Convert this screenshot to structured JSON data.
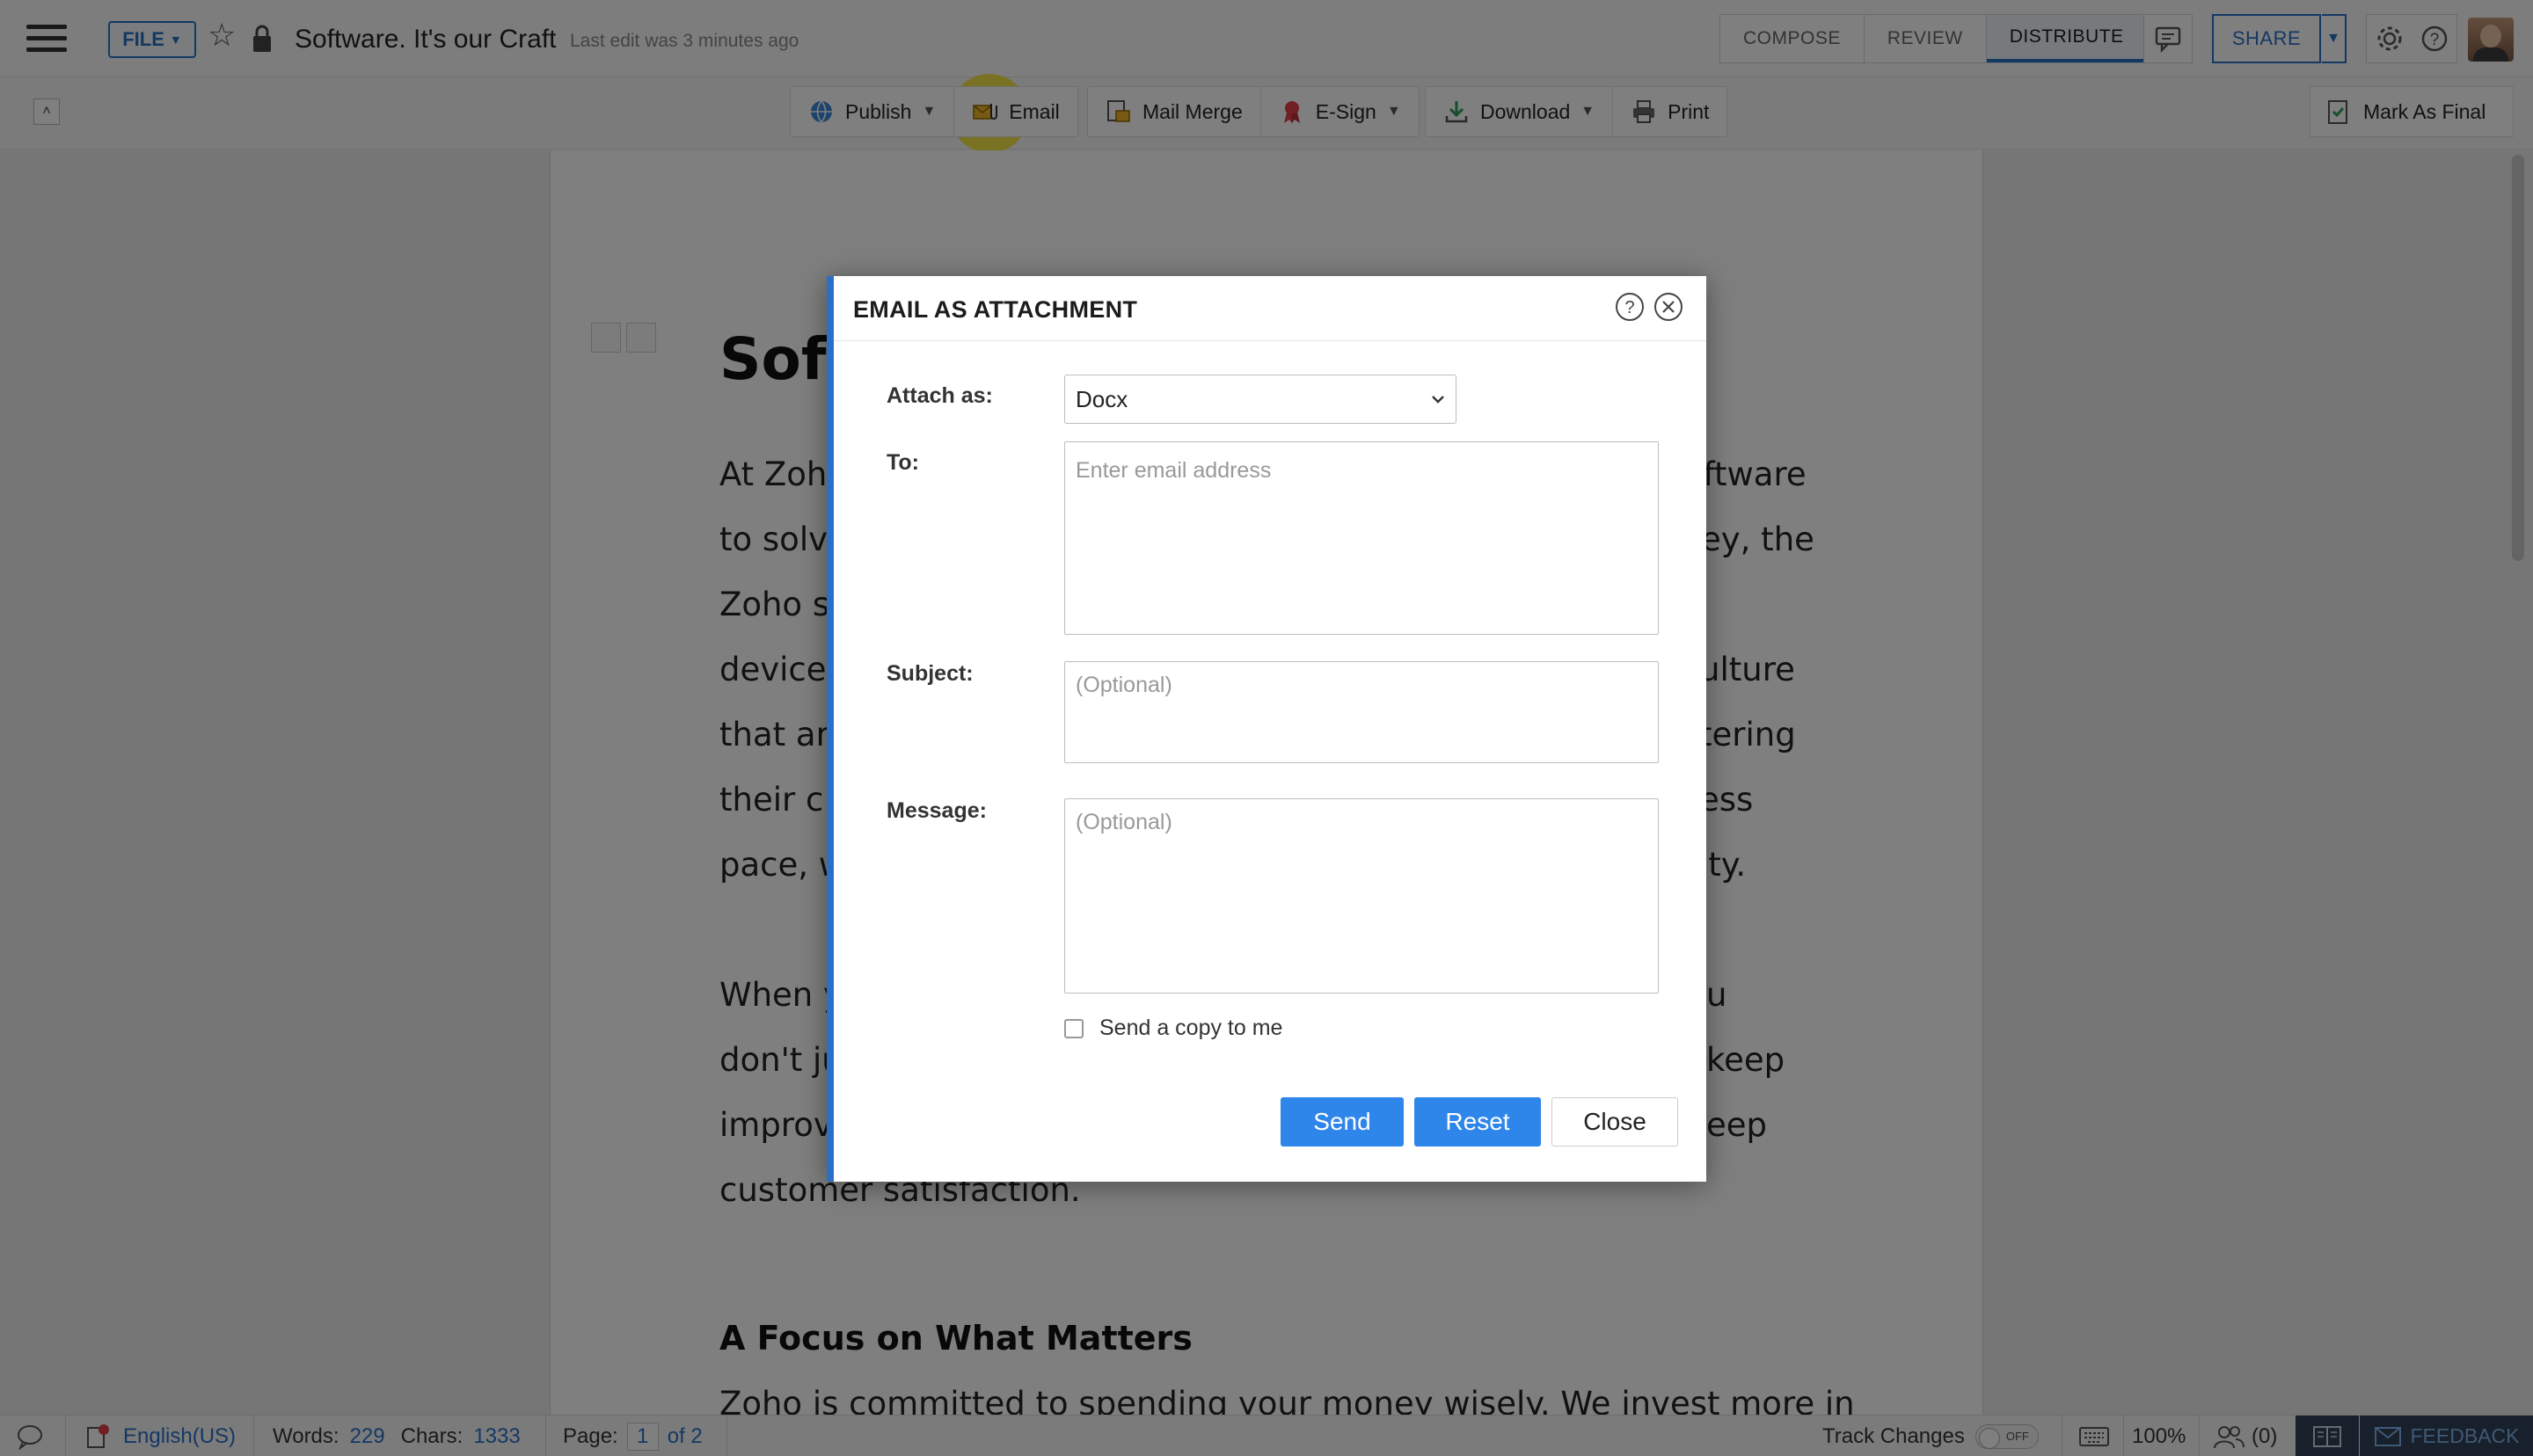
{
  "header": {
    "file_label": "FILE",
    "doc_title": "Software. It's our Craft",
    "last_edit": "Last edit was 3 minutes ago",
    "modes": [
      {
        "label": "COMPOSE"
      },
      {
        "label": "REVIEW"
      },
      {
        "label": "DISTRIBUTE"
      }
    ],
    "share_label": "SHARE"
  },
  "toolbar": {
    "publish": "Publish",
    "email": "Email",
    "mail_merge": "Mail Merge",
    "esign": "E-Sign",
    "download": "Download",
    "print": "Print",
    "mark_final": "Mark As Final"
  },
  "document": {
    "title_visible": "Soft",
    "lines": [
      {
        "left": "At Zoho",
        "right": "oftware"
      },
      {
        "left": "to solve",
        "right": "ey, the"
      },
      {
        "left": "Zoho su",
        "right": ""
      },
      {
        "left": "devices",
        "right": "ulture"
      },
      {
        "left": "that are",
        "right": "tering"
      },
      {
        "left": "their  c",
        "right": "ess"
      },
      {
        "left": "pace, w",
        "right": "ity."
      },
      {
        "left": "When y",
        "right": "u"
      },
      {
        "left": "don't ju",
        "right": "keep"
      },
      {
        "left": "improv",
        "right": "eep"
      },
      {
        "left": "customer satisfaction.",
        "right": ""
      }
    ],
    "heading2": "A Focus on What Matters",
    "last_line": "Zoho is committed to spending your money wisely. We invest more in"
  },
  "dialog": {
    "title": "EMAIL AS ATTACHMENT",
    "attach_label": "Attach as:",
    "attach_value": "Docx",
    "to_label": "To:",
    "to_placeholder": "Enter email address",
    "subject_label": "Subject:",
    "subject_placeholder": "(Optional)",
    "message_label": "Message:",
    "message_placeholder": "(Optional)",
    "copy_label": "Send a copy to me",
    "send": "Send",
    "reset": "Reset",
    "close": "Close"
  },
  "status": {
    "language": "English(US)",
    "words_label": "Words:",
    "words": "229",
    "chars_label": "Chars:",
    "chars": "1333",
    "page_label": "Page:",
    "page": "1",
    "of_pages": "of 2",
    "track_changes": "Track Changes",
    "toggle_state": "OFF",
    "zoom": "100%",
    "collaborators": "(0)",
    "feedback": "FEEDBACK"
  },
  "colors": {
    "accent": "#2a70c6",
    "button_primary": "#2f86ea",
    "highlight": "#f5e228"
  }
}
